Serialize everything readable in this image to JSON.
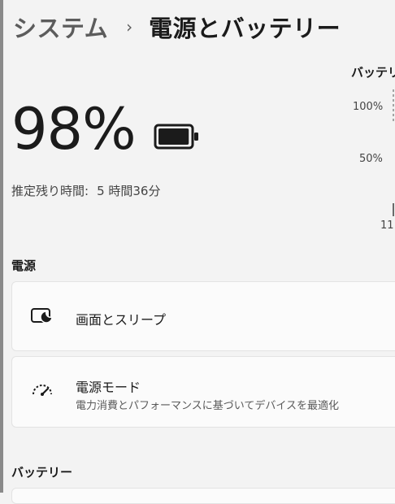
{
  "breadcrumb": {
    "parent": "システム",
    "separator": "›",
    "current": "電源とバッテリー"
  },
  "battery": {
    "percent": "98%",
    "remaining_label": "推定残り時間:",
    "remaining_value": "5 時間36分",
    "level_fraction": 0.98
  },
  "chart": {
    "title": "バッテリ",
    "tick_100": "100%",
    "tick_50": "50%",
    "tick_time": "11:"
  },
  "power": {
    "section_title": "電源",
    "screen_sleep": {
      "label": "画面とスリープ",
      "icon": "screen-sleep-icon"
    },
    "power_mode": {
      "label": "電源モード",
      "description": "電力消費とパフォーマンスに基づいてデバイスを最適化",
      "icon": "speedometer-icon"
    }
  },
  "battery_section": {
    "section_title": "バッテリー"
  },
  "colors": {
    "background": "#f3f3f3",
    "card": "#fbfbfb",
    "battery_fill": "#1b1b1b"
  }
}
